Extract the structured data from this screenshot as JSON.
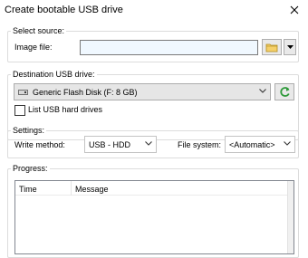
{
  "window": {
    "title": "Create bootable USB drive",
    "close_icon": "close-icon"
  },
  "source": {
    "legend": "Select source:",
    "image_label": "Image file:",
    "image_value": "",
    "browse_icon": "folder-icon",
    "dropdown_icon": "dropdown-arrow-icon"
  },
  "destination": {
    "legend": "Destination USB drive:",
    "drive_icon": "drive-icon",
    "selected_drive": "Generic Flash Disk (F:  8 GB)",
    "refresh_icon": "refresh-icon",
    "list_hdd_label": "List USB hard drives",
    "list_hdd_checked": false
  },
  "settings": {
    "legend": "Settings:",
    "write_method_label": "Write method:",
    "write_method_value": "USB - HDD",
    "filesystem_label": "File system:",
    "filesystem_value": "<Automatic>"
  },
  "progress": {
    "legend": "Progress:",
    "columns": [
      "Time",
      "Message"
    ]
  },
  "colors": {
    "input_bg": "#f0f8ff",
    "refresh_green": "#2e9a3a",
    "folder_yellow": "#e8b93a"
  }
}
